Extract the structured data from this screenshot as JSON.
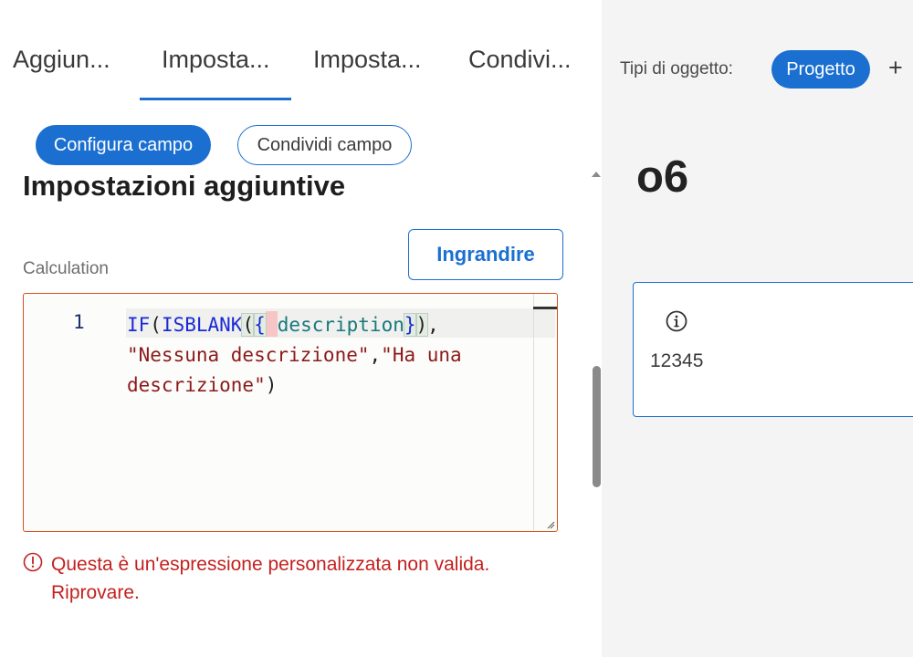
{
  "tabs": [
    {
      "label": "Aggiun..."
    },
    {
      "label": "Imposta...",
      "active": true
    },
    {
      "label": "Imposta..."
    },
    {
      "label": "Condivi..."
    }
  ],
  "actions": {
    "configure_label": "Configura campo",
    "share_label": "Condividi campo"
  },
  "section": {
    "title": "Impostazioni aggiuntive",
    "field_label": "Calculation",
    "expand_label": "Ingrandire"
  },
  "editor": {
    "line_number": "1",
    "tokens": {
      "if": "IF",
      "open_paren_1": "(",
      "isblank": "ISBLANK",
      "open_paren_2": "(",
      "open_brace": "{",
      "field": "description",
      "close_brace": "}",
      "close_paren_2": ")",
      "comma_1": ",",
      "string_1": "\"Nessuna descrizione\"",
      "comma_2": ",",
      "string_2_part_1": "\"Ha una",
      "string_2_part_2": "descrizione\"",
      "close_paren_1": ")"
    }
  },
  "error": {
    "message": "Questa è un'espressione personalizzata non valida. Riprovare."
  },
  "preview": {
    "object_types_label": "Tipi di oggetto:",
    "object_type": "Progetto",
    "add_symbol": "+",
    "title": "o6",
    "card_value": "12345"
  },
  "colors": {
    "accent": "#1a6fd1",
    "error": "#c3211f",
    "editor_border": "#d4501f"
  },
  "icons": [
    "error-circle-icon",
    "info-icon",
    "plus-icon",
    "caret-up-icon",
    "resize-grip-icon"
  ]
}
